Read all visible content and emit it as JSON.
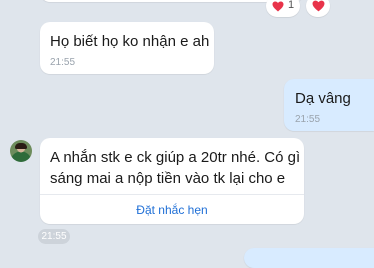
{
  "messages": {
    "top_reaction_count": "1",
    "msg1": {
      "text": "Họ biết họ ko nhận e ah",
      "time": "21:55"
    },
    "msg2": {
      "text": "Dạ vâng",
      "time": "21:55"
    },
    "msg3": {
      "line1": "A nhắn stk e ck giúp a 20tr nhé. Có gì",
      "line2": "sáng mai a nộp tiền vào tk lại cho e",
      "action": "Đặt nhắc hẹn",
      "time": "21:55"
    }
  },
  "colors": {
    "background": "#dfe5ec",
    "incoming": "#ffffff",
    "outgoing": "#d8ebff",
    "reaction": "#e8334a",
    "link": "#1f6fd6"
  },
  "icons": {
    "reaction": "heart-icon",
    "reaction_picker": "heart-icon"
  }
}
